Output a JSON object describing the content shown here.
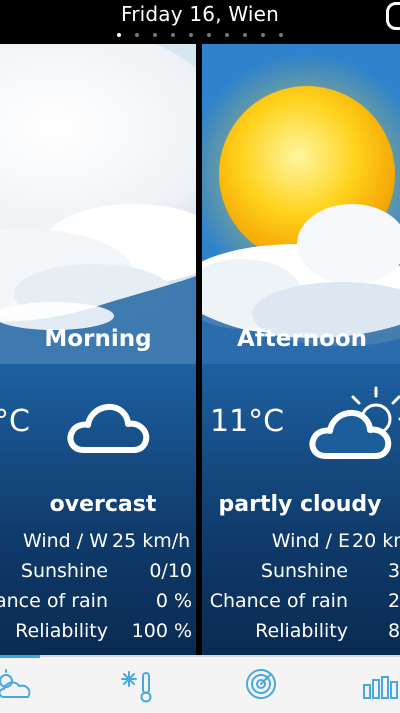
{
  "header": {
    "title": "Friday 16, Wien",
    "pages": 10,
    "active_page": 0
  },
  "panels": [
    {
      "period": "Morning",
      "temperature": "°C",
      "condition": "overcast",
      "icon": "cloud-icon",
      "rows": [
        {
          "label": "Wind / W",
          "value": "25 km/h"
        },
        {
          "label": "Sunshine",
          "value": "0/10"
        },
        {
          "label": "ance of rain",
          "value": "0 %"
        },
        {
          "label": "Reliability",
          "value": "100 %"
        }
      ]
    },
    {
      "period": "Afternoon",
      "temperature": "11°C",
      "condition": "partly cloudy",
      "icon": "sun-cloud-icon",
      "rows": [
        {
          "label": "Wind / E",
          "value": "20 km"
        },
        {
          "label": "Sunshine",
          "value": "3"
        },
        {
          "label": "Chance of rain",
          "value": "2"
        },
        {
          "label": "Reliability",
          "value": "8"
        }
      ]
    }
  ],
  "tabs": [
    {
      "name": "forecast",
      "icon": "weather-icon",
      "active": true
    },
    {
      "name": "temperature",
      "icon": "snow-thermometer-icon",
      "active": false
    },
    {
      "name": "radar",
      "icon": "radar-icon",
      "active": false
    },
    {
      "name": "charts",
      "icon": "bar-chart-icon",
      "active": false
    }
  ],
  "colors": {
    "accent": "#3aa6e6",
    "sky_top": "#3a8ad4",
    "sky_bottom": "#0a2b52",
    "tab_icon": "#4aa8e0"
  }
}
